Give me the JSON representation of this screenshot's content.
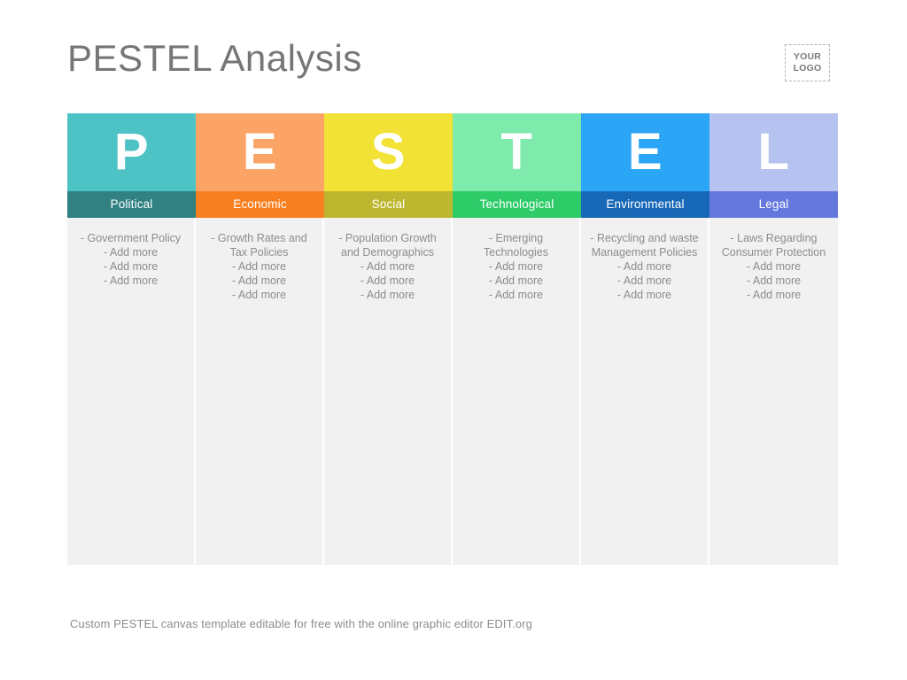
{
  "header": {
    "title": "PESTEL Analysis",
    "logo": {
      "line1": "YOUR",
      "line2": "LOGO"
    }
  },
  "matrix": {
    "columns": [
      {
        "letter": "P",
        "label": "Political",
        "letter_bg": "#4ec3c5",
        "label_bg": "#318183",
        "items": [
          "- Government Policy",
          "- Add more",
          "- Add more",
          "- Add more"
        ]
      },
      {
        "letter": "E",
        "label": "Economic",
        "letter_bg": "#fba465",
        "label_bg": "#f98020",
        "items": [
          "- Growth Rates and\nTax Policies",
          "- Add more",
          "- Add more",
          "- Add more"
        ]
      },
      {
        "letter": "S",
        "label": "Social",
        "letter_bg": "#f3e236",
        "label_bg": "#bdb72f",
        "items": [
          "- Population Growth\nand Demographics",
          "- Add more",
          "- Add more",
          "- Add more"
        ]
      },
      {
        "letter": "T",
        "label": "Technological",
        "letter_bg": "#7eeaab",
        "label_bg": "#2ecc68",
        "items": [
          "- Emerging\nTechnologies",
          "- Add more",
          "- Add more",
          "- Add more"
        ]
      },
      {
        "letter": "E",
        "label": "Environmental",
        "letter_bg": "#2ba6f7",
        "label_bg": "#1868b8",
        "items": [
          "- Recycling and waste\nManagement Policies",
          "- Add more",
          "- Add more",
          "- Add more"
        ]
      },
      {
        "letter": "L",
        "label": "Legal",
        "letter_bg": "#b6c2ef",
        "label_bg": "#6478dd",
        "items": [
          "- Laws Regarding\nConsumer Protection",
          "- Add more",
          "- Add more",
          "- Add more"
        ]
      }
    ]
  },
  "footer": {
    "note": "Custom PESTEL canvas template editable for free with the online graphic editor EDIT.org"
  }
}
